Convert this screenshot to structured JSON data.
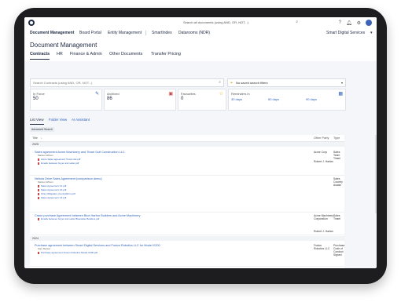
{
  "topbar": {
    "search_placeholder": "Search all documents (using AND, OR, NOT...)",
    "icons": [
      "help-icon",
      "bell-icon",
      "settings-icon",
      "user-avatar"
    ]
  },
  "nav": {
    "items": [
      "Document Management",
      "Board Portal",
      "Entity Management",
      "SmartIndex",
      "Datarooms (NDR)"
    ],
    "company": "Smart Digital Services"
  },
  "page": {
    "title": "Document Management",
    "tabs": [
      "Contracts",
      "HR",
      "Finance & Admin",
      "Other Documents",
      "Transfer Pricing"
    ]
  },
  "search": {
    "placeholder": "Search Contracts (using AND, OR, NOT...)",
    "filter_label": "No saved search filters"
  },
  "cards": {
    "in_force_label": "In Force",
    "in_force_value": "50",
    "archived_label": "Archived",
    "archived_value": "86",
    "favourites_label": "Favourites",
    "favourites_value": "0",
    "reminders_label": "Reminders in",
    "reminders": [
      "30 days",
      "60 days",
      "90 days"
    ]
  },
  "views": {
    "tabs": [
      "List View",
      "Folder View",
      "AI Assistant"
    ],
    "advanced_search": "Advanced Search"
  },
  "table": {
    "headers": [
      "Title",
      "Other Party",
      "Type"
    ],
    "groups": [
      "2025",
      "2024"
    ],
    "rows": [
      {
        "title": "Sales agreement Acme Machinery and Tinsel Gulf Construction LLC",
        "by": "Markus Wilson",
        "files": [
          "Acme Sales agreement Tinsel Hot.pdf",
          "Emails between buyer and seller.pdf"
        ],
        "party1": "Acme Corp",
        "party2": "Robert J. Harlan",
        "type1": "Sales",
        "type2": "Team Tinsel"
      },
      {
        "title": "Nebula Drive Sales Agreement (comparison demo)",
        "by": "Markus Wilson",
        "files": [
          "Sales Agreement V1.pdf",
          "Sales Agreement V2.pdf",
          "Oral_Obligation_Kontrollform.pdf",
          "Sales Agreement V3.pdf"
        ],
        "party1": "",
        "party2": "",
        "type1": "Sales",
        "type2": "Country Avatar"
      },
      {
        "title": "Crane purchase Agreement between Blue Harbor Builders and Acme Machinery",
        "by": "",
        "files": [
          "Emails between buyer and seller Bluewater Builders.pdf"
        ],
        "party1": "Acme Machinery Corporation",
        "party2": "Robert J. Harlan",
        "type1": "Sales",
        "type2": "Tinsel"
      },
      {
        "title": "Purchase agreement between Smart Digital Services and Fusion Robotics LLC for Model X200",
        "by": "Sam Becker",
        "files": [
          "Purchase agreement Fusion Robotics Model X200.pdf"
        ],
        "party1": "Fusion Robotics LLC",
        "party2": "",
        "type1": "Purchase",
        "type2": "Code of Conduct Signed"
      }
    ]
  }
}
